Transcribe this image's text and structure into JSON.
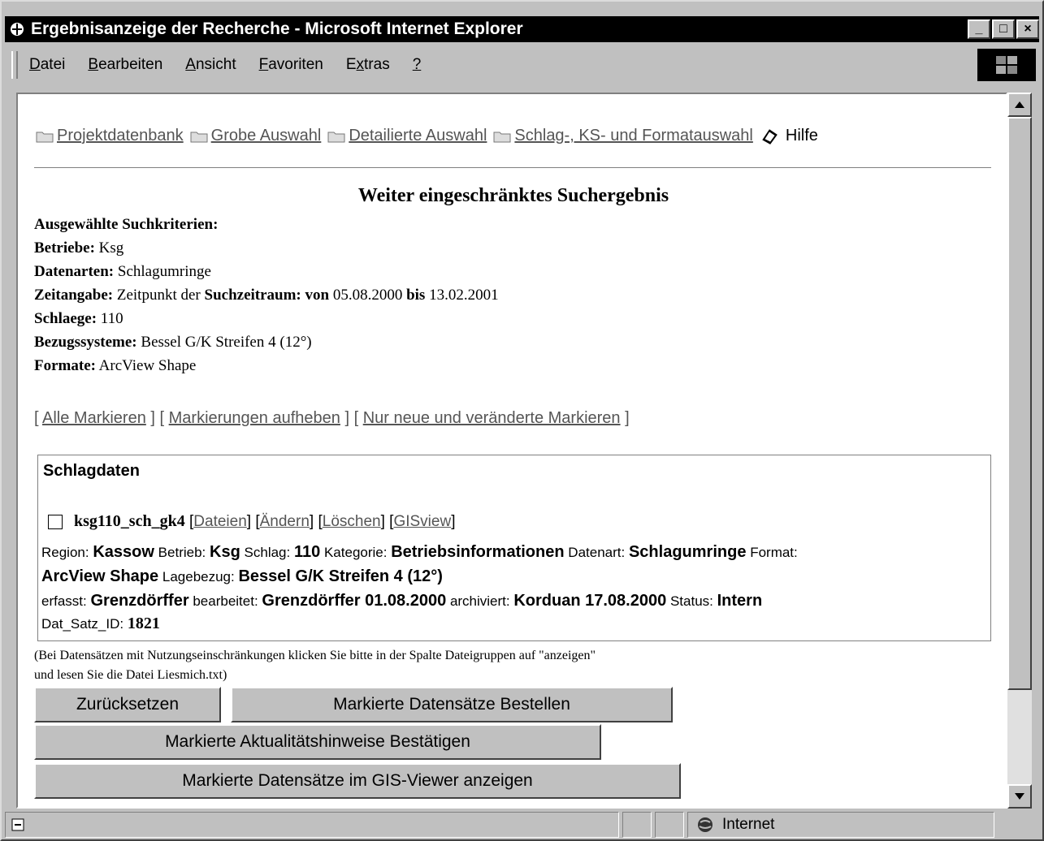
{
  "window": {
    "title": "Ergebnisanzeige der Recherche - Microsoft Internet Explorer",
    "controls": [
      "_",
      "□",
      "×"
    ]
  },
  "menu": [
    {
      "underline": "D",
      "rest": "atei"
    },
    {
      "underline": "B",
      "rest": "earbeiten"
    },
    {
      "underline": "A",
      "rest": "nsicht"
    },
    {
      "underline": "F",
      "rest": "avoriten"
    },
    {
      "pre": "E",
      "underline": "x",
      "rest": "tras"
    },
    {
      "underline": "?",
      "rest": ""
    }
  ],
  "breadcrumbs": [
    "Projektdatenbank",
    "Grobe Auswahl",
    "Detailierte Auswahl",
    "Schlag-, KS- und Formatauswahl"
  ],
  "help_label": "Hilfe",
  "heading": "Weiter eingeschränktes Suchergebnis",
  "criteria": {
    "title": "Ausgewählte Suchkriterien:",
    "betriebe_label": "Betriebe:",
    "betriebe_value": "Ksg",
    "datenarten_label": "Datenarten:",
    "datenarten_value": "Schlagumringe",
    "zeit_label": "Zeitangabe:",
    "zeit_text": "Zeitpunkt der",
    "suchzeitraum_label": "Suchzeitraum: von",
    "von_value": "05.08.2000",
    "bis_label": "bis",
    "bis_value": "13.02.2001",
    "schlaege_label": "Schlaege:",
    "schlaege_value": "110",
    "bezug_label": "Bezugssysteme:",
    "bezug_value": "Bessel G/K Streifen 4 (12°)",
    "formate_label": "Formate:",
    "formate_value": "ArcView Shape"
  },
  "mark_links": [
    "Alle Markieren",
    "Markierungen aufheben",
    "Nur neue und veränderte Markieren"
  ],
  "section_title": "Schlagdaten",
  "record": {
    "id": "ksg110_sch_gk4",
    "links": [
      "Dateien",
      "Ändern",
      "Löschen",
      "GISview"
    ],
    "region_label": "Region:",
    "region": "Kassow",
    "betrieb_label": "Betrieb:",
    "betrieb": "Ksg",
    "schlag_label": "Schlag:",
    "schlag": "110",
    "kategorie_label": "Kategorie:",
    "kategorie": "Betriebsinformationen",
    "datenart_label": "Datenart:",
    "datenart": "Schlagumringe",
    "format_label": "Format:",
    "format": "ArcView Shape",
    "lagebezug_label": "Lagebezug:",
    "lagebezug": "Bessel G/K Streifen 4 (12°)",
    "erfasst_label": "erfasst:",
    "erfasst": "Grenzdörffer",
    "bearbeitet_label": "bearbeitet:",
    "bearbeitet": "Grenzdörffer 01.08.2000",
    "archiviert_label": "archiviert:",
    "archiviert": "Korduan 17.08.2000",
    "status_label": "Status:",
    "status": "Intern",
    "satzid_label": "Dat_Satz_ID:",
    "satzid": "1821"
  },
  "note_lines": [
    "(Bei Datensätzen mit Nutzungseinschränkungen klicken Sie bitte in der Spalte Dateigruppen auf \"anzeigen\"",
    "und lesen Sie die Datei Liesmich.txt)"
  ],
  "buttons": {
    "reset": "Zurücksetzen",
    "order": "Markierte Datensätze Bestellen",
    "confirm": "Markierte Aktualitätshinweise Bestätigen",
    "gis": "Markierte Datensätze im GIS-Viewer anzeigen"
  },
  "status": {
    "zone": "Internet"
  }
}
